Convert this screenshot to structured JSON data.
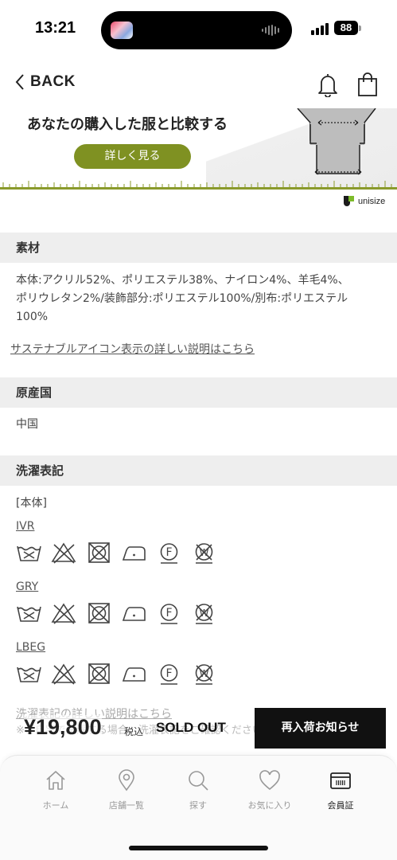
{
  "status": {
    "time": "13:21",
    "battery": "88"
  },
  "header": {
    "back_label": "BACK"
  },
  "banner": {
    "title": "あなたの購入した服と比較する",
    "button_label": "詳しく見る",
    "brand": "unisize"
  },
  "material": {
    "heading": "素材",
    "lines": [
      "本体:アクリル52%、ポリエステル38%、ナイロン4%、羊毛4%、",
      "ポリウレタン2%/装飾部分:ポリエステル100%/別布:ポリエステル",
      "100%"
    ],
    "sustainable_link": "サステナブルアイコン表示の詳しい説明はこちら"
  },
  "origin": {
    "heading": "原産国",
    "value": "中国"
  },
  "care": {
    "heading": "洗濯表記",
    "body_label": "[本体]",
    "colors": [
      {
        "label": "IVR",
        "icons": [
          "hand-wash-icon",
          "no-bleach-icon",
          "no-tumble-dry-icon",
          "iron-low-icon",
          "dry-clean-f-icon",
          "no-wet-clean-icon"
        ]
      },
      {
        "label": "GRY",
        "icons": [
          "hand-wash-icon",
          "no-bleach-icon",
          "no-tumble-dry-icon",
          "iron-low-icon",
          "dry-clean-f-icon",
          "no-wet-clean-icon"
        ]
      },
      {
        "label": "LBEG",
        "icons": [
          "hand-wash-icon",
          "no-bleach-icon",
          "no-tumble-dry-icon",
          "iron-low-icon",
          "dry-clean-f-icon",
          "no-wet-clean-icon"
        ]
      }
    ],
    "detail_link": "洗濯表記の詳しい説明はこちら",
    "note": "※ご自宅で洗濯する場合、洗濯表記をご確認ください。場合"
  },
  "purchase": {
    "price": "¥19,800",
    "tax_label": "税込",
    "status": "SOLD OUT",
    "restock_button": "再入荷お知らせ"
  },
  "tabs": [
    {
      "label": "ホーム",
      "icon": "home-icon"
    },
    {
      "label": "店舗一覧",
      "icon": "location-pin-icon"
    },
    {
      "label": "探す",
      "icon": "search-icon"
    },
    {
      "label": "お気に入り",
      "icon": "heart-icon"
    },
    {
      "label": "会員証",
      "icon": "member-card-icon",
      "active": true
    }
  ],
  "colors": {
    "accent": "#7f9122",
    "ruler": "#8a9a2b",
    "section_bg": "#eeeeee"
  }
}
